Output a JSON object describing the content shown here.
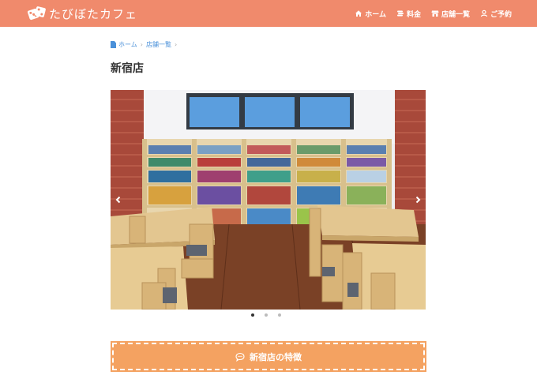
{
  "brand": {
    "logo_text": "たびぼたカフェ"
  },
  "nav": {
    "items": [
      {
        "label": "ホーム",
        "icon": "home-icon"
      },
      {
        "label": "料金",
        "icon": "coins-icon"
      },
      {
        "label": "店舗一覧",
        "icon": "store-icon"
      },
      {
        "label": "ご予約",
        "icon": "user-icon"
      }
    ]
  },
  "breadcrumb": {
    "items": [
      "ホーム",
      "店舗一覧"
    ]
  },
  "page": {
    "title": "新宿店"
  },
  "carousel": {
    "slide_count": 3,
    "active_index": 0,
    "image_icon": "cafe-interior-photo"
  },
  "feature_section": {
    "label": "新宿店の特徴",
    "icon": "chat-bubble-icon"
  },
  "colors": {
    "header": "#f08a6c",
    "accent_button": "#f4a261",
    "link": "#4a90d9"
  }
}
